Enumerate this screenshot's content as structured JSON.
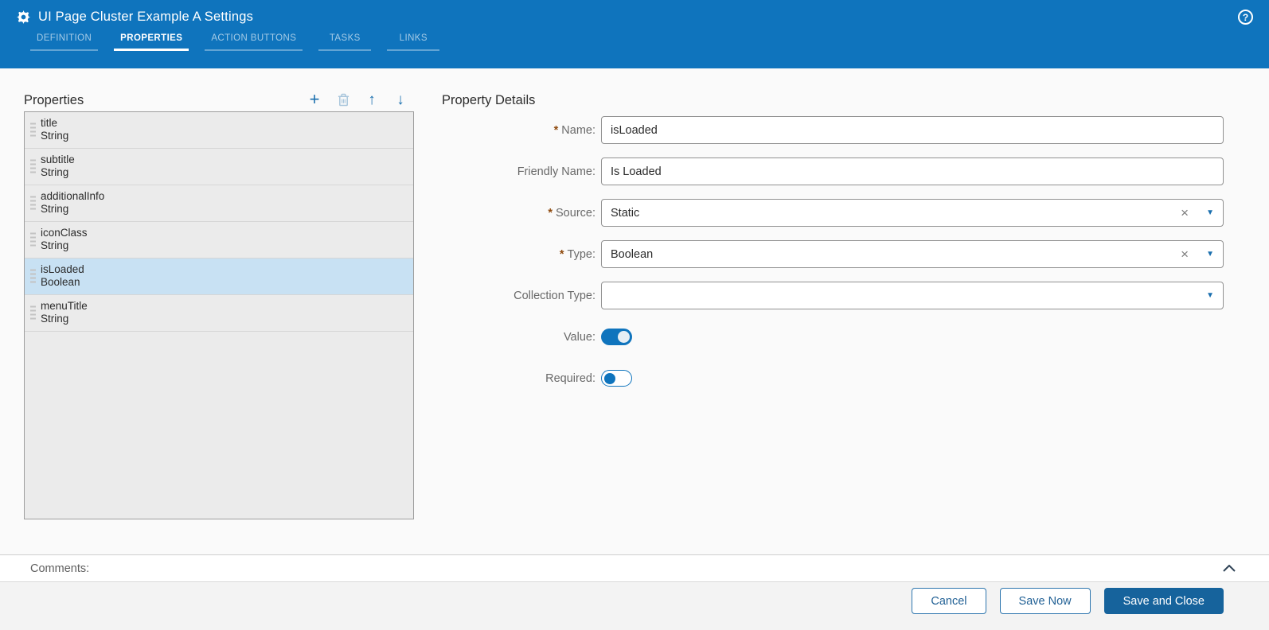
{
  "header": {
    "title": "UI Page Cluster Example A Settings",
    "help_label": "?",
    "tabs": [
      {
        "label": "DEFINITION",
        "active": false
      },
      {
        "label": "PROPERTIES",
        "active": true
      },
      {
        "label": "ACTION BUTTONS",
        "active": false
      },
      {
        "label": "TASKS",
        "active": false
      },
      {
        "label": "LINKS",
        "active": false
      }
    ]
  },
  "properties_panel": {
    "title": "Properties",
    "toolbar": {
      "add": "+",
      "move_up": "↑",
      "move_down": "↓"
    },
    "items": [
      {
        "name": "title",
        "type": "String",
        "selected": false
      },
      {
        "name": "subtitle",
        "type": "String",
        "selected": false
      },
      {
        "name": "additionalInfo",
        "type": "String",
        "selected": false
      },
      {
        "name": "iconClass",
        "type": "String",
        "selected": false
      },
      {
        "name": "isLoaded",
        "type": "Boolean",
        "selected": true
      },
      {
        "name": "menuTitle",
        "type": "String",
        "selected": false
      }
    ]
  },
  "details_panel": {
    "title": "Property Details",
    "required_marker": "*",
    "clear_glyph": "×",
    "caret_glyph": "▼",
    "name": {
      "label": "Name:",
      "required": true,
      "value": "isLoaded"
    },
    "friendly_name": {
      "label": "Friendly Name:",
      "required": false,
      "value": "Is Loaded"
    },
    "source": {
      "label": "Source:",
      "required": true,
      "value": "Static"
    },
    "type": {
      "label": "Type:",
      "required": true,
      "value": "Boolean"
    },
    "collection_type": {
      "label": "Collection Type:",
      "required": false,
      "value": ""
    },
    "value_toggle": {
      "label": "Value:",
      "state": "on"
    },
    "required_toggle": {
      "label": "Required:",
      "state": "off"
    }
  },
  "comments": {
    "label": "Comments:"
  },
  "footer": {
    "cancel": "Cancel",
    "save_now": "Save Now",
    "save_and_close": "Save and Close"
  },
  "colors": {
    "header_blue": "#0f74bd",
    "accent_blue": "#1a6fae",
    "primary_button": "#16639c",
    "selected_row": "#c8e1f3",
    "required_asterisk": "#8f4a0e"
  }
}
